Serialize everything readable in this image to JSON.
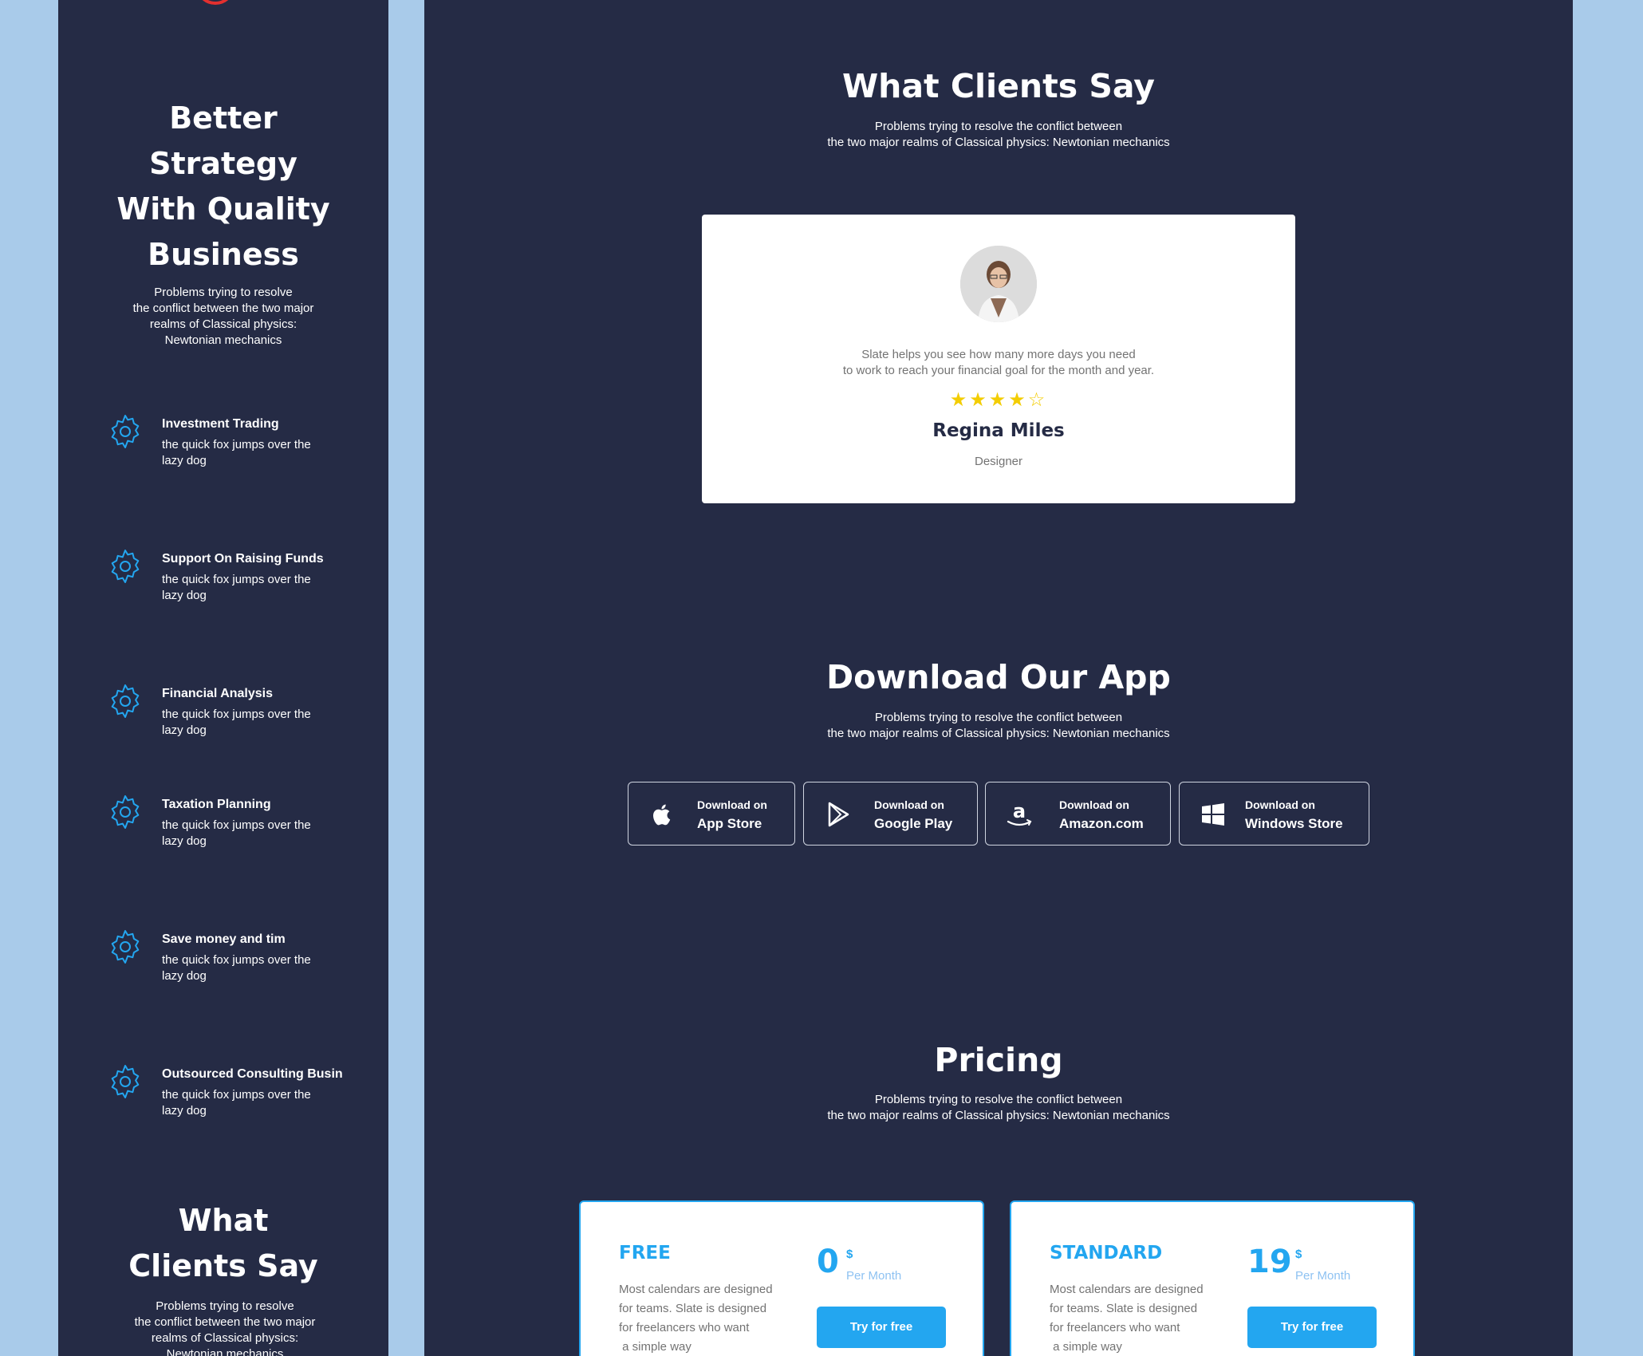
{
  "sidebar": {
    "hero": {
      "title_lines": [
        "Better",
        "Strategy",
        "With Quality",
        "Business"
      ],
      "description_lines": [
        "Problems trying to resolve",
        "the conflict between the two major",
        "realms of Classical physics:",
        "Newtonian mechanics"
      ]
    },
    "features": [
      {
        "title": "Investment Trading",
        "desc_lines": [
          "the quick fox jumps over the",
          "lazy dog"
        ],
        "icon": "gear-icon"
      },
      {
        "title": "Support On Raising Funds",
        "desc_lines": [
          "the quick fox jumps over the",
          "lazy dog"
        ],
        "icon": "gear-icon"
      },
      {
        "title": "Financial Analysis",
        "desc_lines": [
          "the quick fox jumps over the",
          "lazy dog"
        ],
        "icon": "gear-icon"
      },
      {
        "title": "Taxation Planning",
        "desc_lines": [
          "the quick fox jumps over the",
          "lazy dog"
        ],
        "icon": "gear-icon"
      },
      {
        "title": "Save money and tim",
        "desc_lines": [
          "the quick fox jumps over the",
          "lazy dog"
        ],
        "icon": "gear-icon"
      },
      {
        "title": "Outsourced Consulting Busin",
        "desc_lines": [
          "the quick fox jumps over the",
          "lazy dog"
        ],
        "icon": "gear-icon"
      }
    ],
    "clients": {
      "title_lines": [
        "What",
        "Clients Say"
      ],
      "description_lines": [
        "Problems trying to resolve",
        "the conflict between the two major",
        "realms of Classical physics:",
        "Newtonian mechanics"
      ]
    }
  },
  "testimonials": {
    "title": "What Clients Say",
    "description_lines": [
      "Problems trying to resolve the conflict between",
      "the two major realms of Classical physics: Newtonian mechanics"
    ],
    "card": {
      "quote_lines": [
        "Slate helps you see how many more days you need",
        "to work to reach your financial goal for the month and year."
      ],
      "rating": 4,
      "rating_max": 5,
      "name": "Regina Miles",
      "role": "Designer"
    }
  },
  "download": {
    "title": "Download Our App",
    "description_lines": [
      "Problems trying to resolve the conflict between",
      "the two major realms of Classical physics: Newtonian mechanics"
    ],
    "stores": [
      {
        "small": "Download on",
        "big": "App Store",
        "icon": "apple-icon"
      },
      {
        "small": "Download on",
        "big": "Google Play",
        "icon": "google-play-icon"
      },
      {
        "small": "Download on",
        "big": "Amazon.com",
        "icon": "amazon-icon"
      },
      {
        "small": "Download on",
        "big": "Windows Store",
        "icon": "windows-icon"
      }
    ]
  },
  "pricing": {
    "title": "Pricing",
    "description_lines": [
      "Problems trying to resolve the conflict between",
      "the two major realms of Classical physics: Newtonian mechanics"
    ],
    "plans": [
      {
        "name": "FREE",
        "price": "0",
        "currency": "$",
        "period": "Per Month",
        "desc_lines": [
          "Most calendars are designed",
          "for teams. Slate is designed",
          "for freelancers who want",
          " a simple way"
        ],
        "cta": "Try for free"
      },
      {
        "name": "STANDARD",
        "price": "19",
        "currency": "$",
        "period": "Per Month",
        "desc_lines": [
          "Most calendars are designed",
          "for teams. Slate is designed",
          "for freelancers who want",
          " a simple way"
        ],
        "cta": "Try for free"
      }
    ]
  },
  "colors": {
    "background": "#a9cbea",
    "panel": "#252b45",
    "accent": "#23a6f0",
    "star": "#f3cd03",
    "muted_text": "#737373",
    "logo_ring": "#e3302f"
  }
}
